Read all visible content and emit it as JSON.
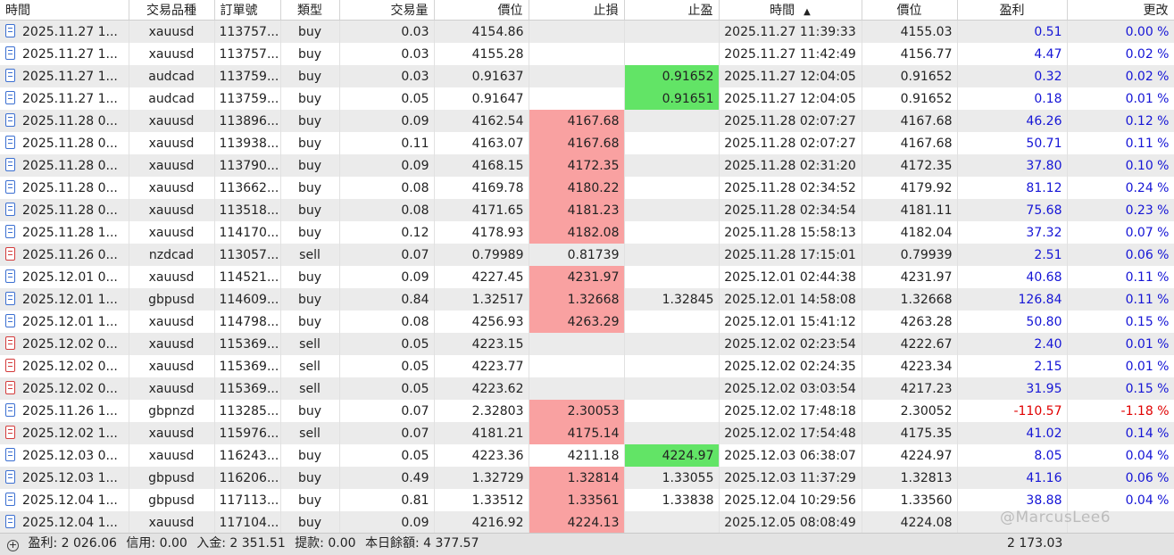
{
  "columns": [
    "時間",
    "交易品種",
    "訂單號",
    "類型",
    "交易量",
    "價位",
    "止損",
    "止盈",
    "時間",
    "價位",
    "盈利",
    "更改"
  ],
  "rows": [
    {
      "side": "buy",
      "time": "2025.11.27 1...",
      "symbol": "xauusd",
      "ticket": "113757...",
      "type": "buy",
      "volume": "0.03",
      "price": "4154.86",
      "sl": "",
      "tp": "",
      "close_time": "2025.11.27 11:39:33",
      "close_price": "4155.03",
      "profit": "0.51",
      "change": "0.00 %",
      "sl_hit": false,
      "tp_hit": false
    },
    {
      "side": "buy",
      "time": "2025.11.27 1...",
      "symbol": "xauusd",
      "ticket": "113757...",
      "type": "buy",
      "volume": "0.03",
      "price": "4155.28",
      "sl": "",
      "tp": "",
      "close_time": "2025.11.27 11:42:49",
      "close_price": "4156.77",
      "profit": "4.47",
      "change": "0.02 %",
      "sl_hit": false,
      "tp_hit": false
    },
    {
      "side": "buy",
      "time": "2025.11.27 1...",
      "symbol": "audcad",
      "ticket": "113759...",
      "type": "buy",
      "volume": "0.03",
      "price": "0.91637",
      "sl": "",
      "tp": "0.91652",
      "close_time": "2025.11.27 12:04:05",
      "close_price": "0.91652",
      "profit": "0.32",
      "change": "0.02 %",
      "sl_hit": false,
      "tp_hit": true
    },
    {
      "side": "buy",
      "time": "2025.11.27 1...",
      "symbol": "audcad",
      "ticket": "113759...",
      "type": "buy",
      "volume": "0.05",
      "price": "0.91647",
      "sl": "",
      "tp": "0.91651",
      "close_time": "2025.11.27 12:04:05",
      "close_price": "0.91652",
      "profit": "0.18",
      "change": "0.01 %",
      "sl_hit": false,
      "tp_hit": true
    },
    {
      "side": "buy",
      "time": "2025.11.28 0...",
      "symbol": "xauusd",
      "ticket": "113896...",
      "type": "buy",
      "volume": "0.09",
      "price": "4162.54",
      "sl": "4167.68",
      "tp": "",
      "close_time": "2025.11.28 02:07:27",
      "close_price": "4167.68",
      "profit": "46.26",
      "change": "0.12 %",
      "sl_hit": true,
      "tp_hit": false
    },
    {
      "side": "buy",
      "time": "2025.11.28 0...",
      "symbol": "xauusd",
      "ticket": "113938...",
      "type": "buy",
      "volume": "0.11",
      "price": "4163.07",
      "sl": "4167.68",
      "tp": "",
      "close_time": "2025.11.28 02:07:27",
      "close_price": "4167.68",
      "profit": "50.71",
      "change": "0.11 %",
      "sl_hit": true,
      "tp_hit": false
    },
    {
      "side": "buy",
      "time": "2025.11.28 0...",
      "symbol": "xauusd",
      "ticket": "113790...",
      "type": "buy",
      "volume": "0.09",
      "price": "4168.15",
      "sl": "4172.35",
      "tp": "",
      "close_time": "2025.11.28 02:31:20",
      "close_price": "4172.35",
      "profit": "37.80",
      "change": "0.10 %",
      "sl_hit": true,
      "tp_hit": false
    },
    {
      "side": "buy",
      "time": "2025.11.28 0...",
      "symbol": "xauusd",
      "ticket": "113662...",
      "type": "buy",
      "volume": "0.08",
      "price": "4169.78",
      "sl": "4180.22",
      "tp": "",
      "close_time": "2025.11.28 02:34:52",
      "close_price": "4179.92",
      "profit": "81.12",
      "change": "0.24 %",
      "sl_hit": true,
      "tp_hit": false
    },
    {
      "side": "buy",
      "time": "2025.11.28 0...",
      "symbol": "xauusd",
      "ticket": "113518...",
      "type": "buy",
      "volume": "0.08",
      "price": "4171.65",
      "sl": "4181.23",
      "tp": "",
      "close_time": "2025.11.28 02:34:54",
      "close_price": "4181.11",
      "profit": "75.68",
      "change": "0.23 %",
      "sl_hit": true,
      "tp_hit": false
    },
    {
      "side": "buy",
      "time": "2025.11.28 1...",
      "symbol": "xauusd",
      "ticket": "114170...",
      "type": "buy",
      "volume": "0.12",
      "price": "4178.93",
      "sl": "4182.08",
      "tp": "",
      "close_time": "2025.11.28 15:58:13",
      "close_price": "4182.04",
      "profit": "37.32",
      "change": "0.07 %",
      "sl_hit": true,
      "tp_hit": false
    },
    {
      "side": "sell",
      "time": "2025.11.26 0...",
      "symbol": "nzdcad",
      "ticket": "113057...",
      "type": "sell",
      "volume": "0.07",
      "price": "0.79989",
      "sl": "0.81739",
      "tp": "",
      "close_time": "2025.11.28 17:15:01",
      "close_price": "0.79939",
      "profit": "2.51",
      "change": "0.06 %",
      "sl_hit": false,
      "tp_hit": false
    },
    {
      "side": "buy",
      "time": "2025.12.01 0...",
      "symbol": "xauusd",
      "ticket": "114521...",
      "type": "buy",
      "volume": "0.09",
      "price": "4227.45",
      "sl": "4231.97",
      "tp": "",
      "close_time": "2025.12.01 02:44:38",
      "close_price": "4231.97",
      "profit": "40.68",
      "change": "0.11 %",
      "sl_hit": true,
      "tp_hit": false
    },
    {
      "side": "buy",
      "time": "2025.12.01 1...",
      "symbol": "gbpusd",
      "ticket": "114609...",
      "type": "buy",
      "volume": "0.84",
      "price": "1.32517",
      "sl": "1.32668",
      "tp": "1.32845",
      "close_time": "2025.12.01 14:58:08",
      "close_price": "1.32668",
      "profit": "126.84",
      "change": "0.11 %",
      "sl_hit": true,
      "tp_hit": false
    },
    {
      "side": "buy",
      "time": "2025.12.01 1...",
      "symbol": "xauusd",
      "ticket": "114798...",
      "type": "buy",
      "volume": "0.08",
      "price": "4256.93",
      "sl": "4263.29",
      "tp": "",
      "close_time": "2025.12.01 15:41:12",
      "close_price": "4263.28",
      "profit": "50.80",
      "change": "0.15 %",
      "sl_hit": true,
      "tp_hit": false
    },
    {
      "side": "sell",
      "time": "2025.12.02 0...",
      "symbol": "xauusd",
      "ticket": "115369...",
      "type": "sell",
      "volume": "0.05",
      "price": "4223.15",
      "sl": "",
      "tp": "",
      "close_time": "2025.12.02 02:23:54",
      "close_price": "4222.67",
      "profit": "2.40",
      "change": "0.01 %",
      "sl_hit": false,
      "tp_hit": false
    },
    {
      "side": "sell",
      "time": "2025.12.02 0...",
      "symbol": "xauusd",
      "ticket": "115369...",
      "type": "sell",
      "volume": "0.05",
      "price": "4223.77",
      "sl": "",
      "tp": "",
      "close_time": "2025.12.02 02:24:35",
      "close_price": "4223.34",
      "profit": "2.15",
      "change": "0.01 %",
      "sl_hit": false,
      "tp_hit": false
    },
    {
      "side": "sell",
      "time": "2025.12.02 0...",
      "symbol": "xauusd",
      "ticket": "115369...",
      "type": "sell",
      "volume": "0.05",
      "price": "4223.62",
      "sl": "",
      "tp": "",
      "close_time": "2025.12.02 03:03:54",
      "close_price": "4217.23",
      "profit": "31.95",
      "change": "0.15 %",
      "sl_hit": false,
      "tp_hit": false
    },
    {
      "side": "buy",
      "time": "2025.11.26 1...",
      "symbol": "gbpnzd",
      "ticket": "113285...",
      "type": "buy",
      "volume": "0.07",
      "price": "2.32803",
      "sl": "2.30053",
      "tp": "",
      "close_time": "2025.12.02 17:48:18",
      "close_price": "2.30052",
      "profit": "-110.57",
      "change": "-1.18 %",
      "sl_hit": true,
      "tp_hit": false
    },
    {
      "side": "sell",
      "time": "2025.12.02 1...",
      "symbol": "xauusd",
      "ticket": "115976...",
      "type": "sell",
      "volume": "0.07",
      "price": "4181.21",
      "sl": "4175.14",
      "tp": "",
      "close_time": "2025.12.02 17:54:48",
      "close_price": "4175.35",
      "profit": "41.02",
      "change": "0.14 %",
      "sl_hit": true,
      "tp_hit": false
    },
    {
      "side": "buy",
      "time": "2025.12.03 0...",
      "symbol": "xauusd",
      "ticket": "116243...",
      "type": "buy",
      "volume": "0.05",
      "price": "4223.36",
      "sl": "4211.18",
      "tp": "4224.97",
      "close_time": "2025.12.03 06:38:07",
      "close_price": "4224.97",
      "profit": "8.05",
      "change": "0.04 %",
      "sl_hit": false,
      "tp_hit": true
    },
    {
      "side": "buy",
      "time": "2025.12.03 1...",
      "symbol": "gbpusd",
      "ticket": "116206...",
      "type": "buy",
      "volume": "0.49",
      "price": "1.32729",
      "sl": "1.32814",
      "tp": "1.33055",
      "close_time": "2025.12.03 11:37:29",
      "close_price": "1.32813",
      "profit": "41.16",
      "change": "0.06 %",
      "sl_hit": true,
      "tp_hit": false
    },
    {
      "side": "buy",
      "time": "2025.12.04 1...",
      "symbol": "gbpusd",
      "ticket": "117113...",
      "type": "buy",
      "volume": "0.81",
      "price": "1.33512",
      "sl": "1.33561",
      "tp": "1.33838",
      "close_time": "2025.12.04 10:29:56",
      "close_price": "1.33560",
      "profit": "38.88",
      "change": "0.04 %",
      "sl_hit": true,
      "tp_hit": false
    },
    {
      "side": "buy",
      "time": "2025.12.04 1...",
      "symbol": "xauusd",
      "ticket": "117104...",
      "type": "buy",
      "volume": "0.09",
      "price": "4216.92",
      "sl": "4224.13",
      "tp": "",
      "close_time": "2025.12.05 08:08:49",
      "close_price": "4224.08",
      "profit": "",
      "change": "",
      "sl_hit": true,
      "tp_hit": false
    }
  ],
  "footer": {
    "profit_label": "盈利:",
    "profit_value": "2 026.06",
    "credit_label": "信用:",
    "credit_value": "0.00",
    "deposit_label": "入金:",
    "deposit_value": "2 351.51",
    "withdraw_label": "提款:",
    "withdraw_value": "0.00",
    "daily_label": "本日餘額:",
    "daily_value": "4 377.57",
    "total": "2 173.03"
  },
  "watermark": "@MarcusLee6",
  "colors": {
    "sl_hit": "#f9a1a1",
    "tp_hit": "#62e466",
    "profit_pos": "#1515d6",
    "profit_neg": "#e00000",
    "row_alt": "#ebebeb"
  },
  "icons": {
    "buy": "position-buy-icon",
    "sell": "position-sell-icon",
    "expand": "expand-icon",
    "sort": "sort-ascending-icon"
  }
}
